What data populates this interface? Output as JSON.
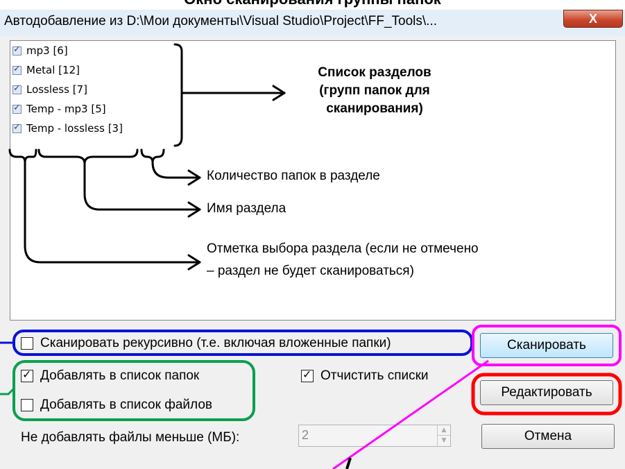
{
  "caption": "Окно сканирования группы папок",
  "window": {
    "title": "Автодобавление из D:\\Мои документы\\Visual Studio\\Project\\FF_Tools\\...",
    "close_label": "X"
  },
  "sections": [
    {
      "label": "mp3 [6]",
      "checked": true
    },
    {
      "label": "Metal [12]",
      "checked": true
    },
    {
      "label": "Lossless [7]",
      "checked": true
    },
    {
      "label": "Temp - mp3 [5]",
      "checked": true
    },
    {
      "label": "Temp - lossless [3]",
      "checked": true
    }
  ],
  "annotations": {
    "sections_list_line1": "Список разделов",
    "sections_list_line2": "(групп папок для",
    "sections_list_line3": "сканирования)",
    "folder_count": "Количество папок в разделе",
    "section_name": "Имя раздела",
    "section_check_line1": "Отметка выбора раздела (если не отмечено",
    "section_check_line2": "– раздел не будет сканироваться)"
  },
  "options": {
    "scan_recursive": {
      "label": "Сканировать рекурсивно (т.е. включая вложенные папки)",
      "checked": false
    },
    "add_to_folders": {
      "label": "Добавлять в список папок",
      "checked": true
    },
    "add_to_files": {
      "label": "Добавлять в список файлов",
      "checked": false
    },
    "clear_lists": {
      "label": "Отчистить списки",
      "checked": true
    }
  },
  "min_size": {
    "label": "Не добавлять файлы меньше (МБ):",
    "value": "2"
  },
  "buttons": {
    "scan": "Сканировать",
    "edit": "Редактировать",
    "cancel": "Отмена"
  },
  "colors": {
    "blue_highlight": "#0a14d6",
    "green_highlight": "#0aa050",
    "magenta_highlight": "#ff00ff",
    "red_highlight": "#ff0000"
  }
}
